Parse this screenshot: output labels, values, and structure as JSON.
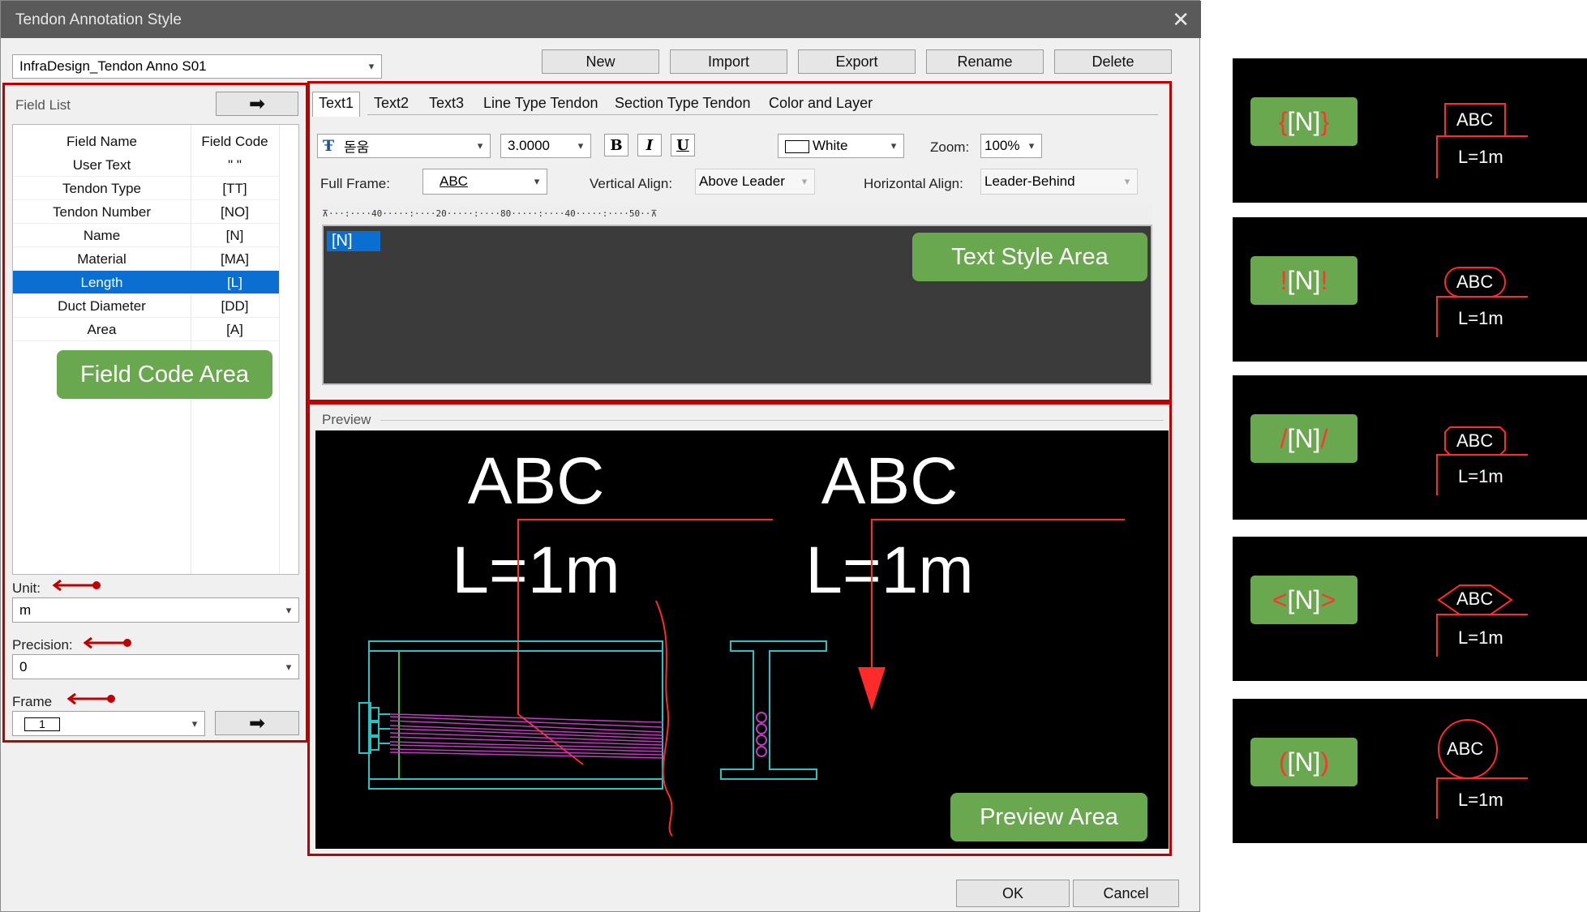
{
  "window": {
    "title": "Tendon Annotation Style",
    "close_glyph": "✕"
  },
  "style_select": {
    "value": "InfraDesign_Tendon Anno S01"
  },
  "toolbar": {
    "new": "New",
    "import": "Import",
    "export": "Export",
    "rename": "Rename",
    "delete": "Delete"
  },
  "field_list": {
    "title": "Field List",
    "header": {
      "name": "Field Name",
      "code": "Field Code"
    },
    "rows": [
      {
        "name": "User Text",
        "code": "\" \""
      },
      {
        "name": "Tendon Type",
        "code": "[TT]"
      },
      {
        "name": "Tendon Number",
        "code": "[NO]"
      },
      {
        "name": "Name",
        "code": "[N]"
      },
      {
        "name": "Material",
        "code": "[MA]"
      },
      {
        "name": "Length",
        "code": "[L]"
      },
      {
        "name": "Duct Diameter",
        "code": "[DD]"
      },
      {
        "name": "Area",
        "code": "[A]"
      }
    ],
    "selected_row": "Length"
  },
  "unit": {
    "label": "Unit:",
    "value": "m"
  },
  "precision": {
    "label": "Precision:",
    "value": "0"
  },
  "frame": {
    "label": "Frame",
    "value": "1"
  },
  "tabs": [
    "Text1",
    "Text2",
    "Text3",
    "Line Type Tendon",
    "Section Type Tendon",
    "Color and Layer"
  ],
  "active_tab": "Text1",
  "text_format": {
    "font_glyph": "Ŧ",
    "font": "돋움",
    "size": "3.0000",
    "bold": "B",
    "italic": "I",
    "underline": "U",
    "color": "White",
    "zoom_label": "Zoom:",
    "zoom": "100%",
    "full_frame_label": "Full Frame:",
    "full_frame": "ABC",
    "valign_label": "Vertical Align:",
    "valign": "Above Leader",
    "halign_label": "Horizontal Align:",
    "halign": "Leader-Behind"
  },
  "ruler_text": "⊼···:····40·····:····20·····:····80·····:····40·····:····50··⊼",
  "editor_token": "[N]",
  "preview": {
    "label": "Preview",
    "top_text": "ABC",
    "bottom_text": "L=1m"
  },
  "callouts": {
    "field_code": "Field Code Area",
    "text_style": "Text Style Area",
    "preview": "Preview Area"
  },
  "footer": {
    "ok": "OK",
    "cancel": "Cancel"
  },
  "thumbnails": [
    {
      "open": "{",
      "token": "[N]",
      "close": "}",
      "frame": "rectangle",
      "top": "ABC",
      "bottom": "L=1m"
    },
    {
      "open": "!",
      "token": "[N]",
      "close": "!",
      "frame": "rounded",
      "top": "ABC",
      "bottom": "L=1m"
    },
    {
      "open": "/",
      "token": "[N]",
      "close": "/",
      "frame": "chamfered",
      "top": "ABC",
      "bottom": "L=1m"
    },
    {
      "open": "<",
      "token": "[N]",
      "close": ">",
      "frame": "hexagon",
      "top": "ABC",
      "bottom": "L=1m"
    },
    {
      "open": "(",
      "token": "[N]",
      "close": ")",
      "frame": "circle",
      "top": "ABC",
      "bottom": "L=1m"
    }
  ],
  "colors": {
    "highlight_red": "#c00000",
    "callout_green": "#6aa84f",
    "selection_blue": "#0a6fd0",
    "leader_red": "#ff2a2a",
    "cad_cyan": "#27c3c3",
    "tendon_magenta": "#c03cc0"
  }
}
